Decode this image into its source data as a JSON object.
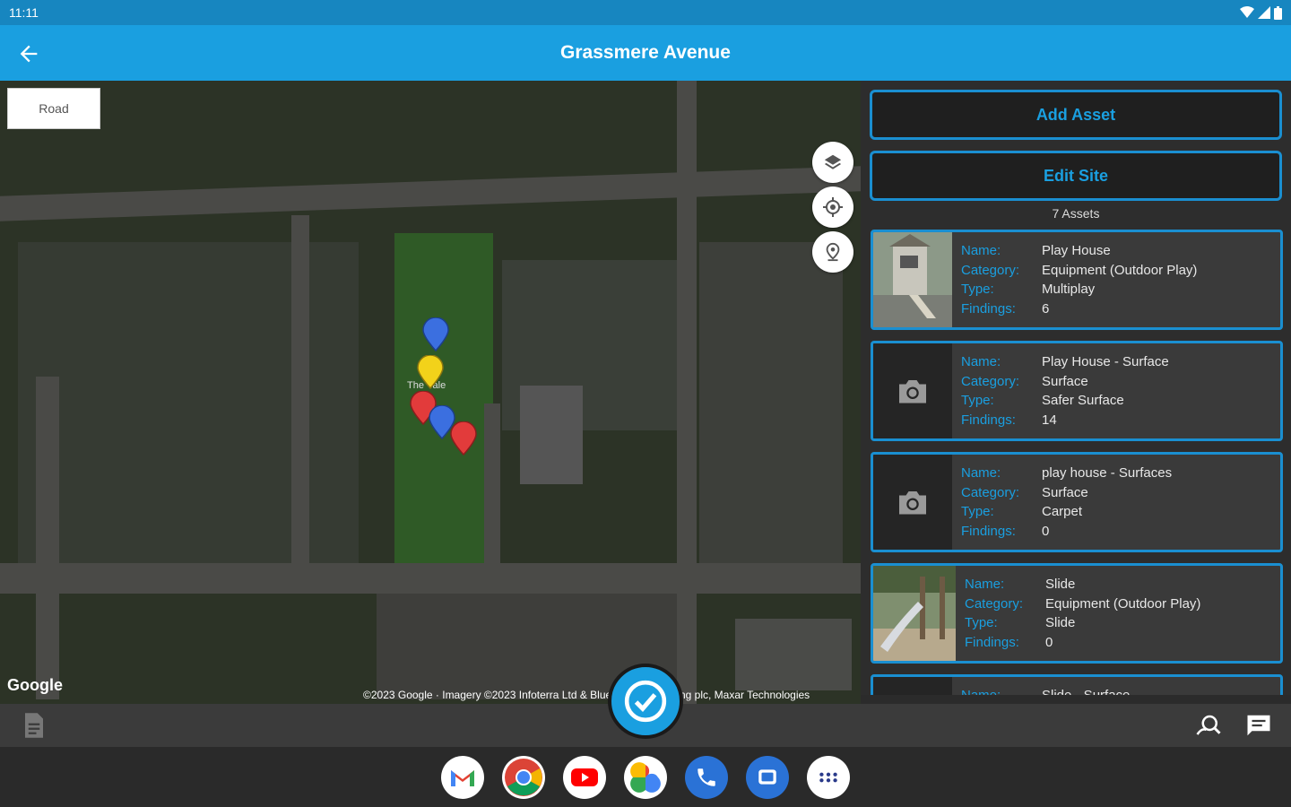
{
  "status": {
    "time": "11:11"
  },
  "header": {
    "title": "Grassmere Avenue",
    "back_label": ""
  },
  "map": {
    "layer_button": "Road",
    "provider": "Google",
    "attribution": "©2023 Google · Imagery ©2023 Infoterra Ltd & Bluesky, Getmapping plc, Maxar Technologies",
    "place_label": "The Vale",
    "markers": [
      {
        "color": "#3b6fe0",
        "kind": "blue"
      },
      {
        "color": "#f2d21a",
        "kind": "yellow"
      },
      {
        "color": "#e23b3b",
        "kind": "red"
      },
      {
        "color": "#3b6fe0",
        "kind": "blue"
      },
      {
        "color": "#e23b3b",
        "kind": "red"
      }
    ]
  },
  "side": {
    "add_asset_label": "Add Asset",
    "edit_site_label": "Edit Site",
    "asset_count": "7 Assets",
    "labels": {
      "name": "Name:",
      "category": "Category:",
      "type": "Type:",
      "findings": "Findings:"
    },
    "assets": [
      {
        "name": "Play House",
        "category": "Equipment (Outdoor Play)",
        "type": "Multiplay",
        "findings": "6",
        "thumb": "photo-playhouse"
      },
      {
        "name": "Play House - Surface",
        "category": "Surface",
        "type": "Safer Surface",
        "findings": "14",
        "thumb": "camera-icon"
      },
      {
        "name": "play house - Surfaces",
        "category": "Surface",
        "type": "Carpet",
        "findings": "0",
        "thumb": "camera-icon"
      },
      {
        "name": "Slide",
        "category": "Equipment (Outdoor Play)",
        "type": "Slide",
        "findings": "0",
        "thumb": "photo-slide"
      },
      {
        "name": "Slide - Surface",
        "category": "",
        "type": "",
        "findings": "",
        "thumb": "camera-icon"
      }
    ]
  },
  "colors": {
    "accent": "#1a9fe0",
    "app_bar": "#1a9fe0",
    "status_bar": "#1786c0"
  }
}
